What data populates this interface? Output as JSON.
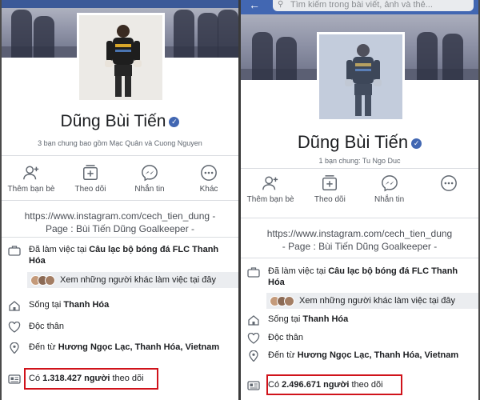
{
  "left": {
    "search_text": "",
    "name": "Dũng Bùi Tiến",
    "mutual": "3 bạn chung bao gồm Mạc Quân và Cuong Nguyen",
    "actions": [
      "Thêm bạn bè",
      "Theo dõi",
      "Nhắn tin",
      "Khác"
    ],
    "bio_line1": "https://www.instagram.com/cech_tien_dung -",
    "bio_line2": "Page : Bùi Tiến Dũng Goalkeeper -",
    "work_prefix": "Đã làm việc tại ",
    "work_place": "Câu lạc bộ bóng đá FLC Thanh Hóa",
    "see_others": "Xem những người khác làm việc tại đây",
    "lives_prefix": "Sống tại ",
    "lives_place": "Thanh Hóa",
    "relationship": "Độc thân",
    "from_prefix": "Đến từ ",
    "from_place": "Hương Ngọc Lạc, Thanh Hóa, Vietnam",
    "followers_prefix": "Có ",
    "followers_count": "1.318.427 người",
    "followers_suffix": " theo dõi"
  },
  "right": {
    "search_text": "Tìm kiếm trong bài viết, ảnh và thẻ...",
    "name": "Dũng Bùi Tiến",
    "mutual": "1 bạn chung: Tu Ngo Duc",
    "actions": [
      "Thêm bạn bè",
      "Theo dõi",
      "Nhắn tin",
      ""
    ],
    "bio_line1": "https://www.instagram.com/cech_tien_dung",
    "bio_line2": "- Page : Bùi Tiến Dũng Goalkeeper -",
    "work_prefix": "Đã làm việc tại ",
    "work_place": "Câu lạc bộ bóng đá FLC Thanh Hóa",
    "see_others": "Xem những người khác làm việc tại đây",
    "lives_prefix": "Sống tại ",
    "lives_place": "Thanh Hóa",
    "relationship": "Độc thân",
    "from_prefix": "Đến từ ",
    "from_place": "Hương Ngọc Lạc, Thanh Hóa, Vietnam",
    "followers_prefix": "Có ",
    "followers_count": "2.496.671 người",
    "followers_suffix": " theo dõi"
  },
  "colors": {
    "facebook_blue": "#4267b2",
    "highlight_red": "#d0131b"
  }
}
